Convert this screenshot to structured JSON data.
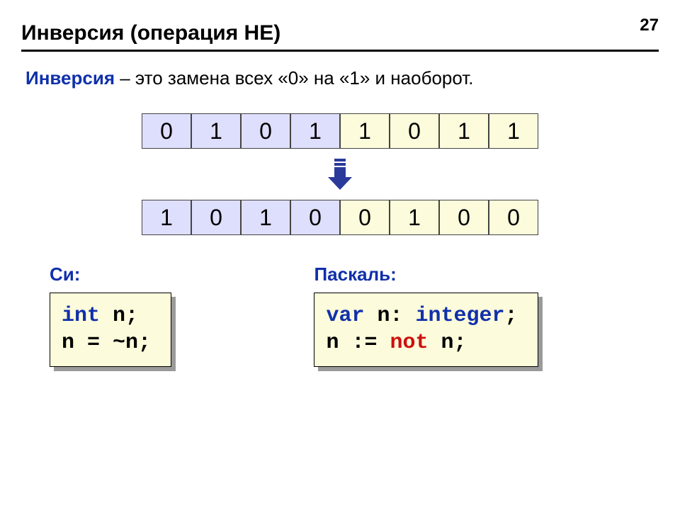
{
  "page_number": "27",
  "title": "Инверсия (операция НЕ)",
  "definition": {
    "term": "Инверсия",
    "rest": " – это замена всех «0» на «1» и наоборот."
  },
  "bits_top": [
    "0",
    "1",
    "0",
    "1",
    "1",
    "0",
    "1",
    "1"
  ],
  "bits_bottom": [
    "1",
    "0",
    "1",
    "0",
    "0",
    "1",
    "0",
    "0"
  ],
  "labels": {
    "c": "Си:",
    "pascal": "Паскаль:"
  },
  "code_c": {
    "l1_kw": "int",
    "l1_rest": " n;",
    "l2": "n = ~n;"
  },
  "code_pascal": {
    "l1_kw": "var",
    "l1_mid": " n: ",
    "l1_type": "integer",
    "l1_end": ";",
    "l2_a": "n := ",
    "l2_kw": "not",
    "l2_b": " n;"
  }
}
